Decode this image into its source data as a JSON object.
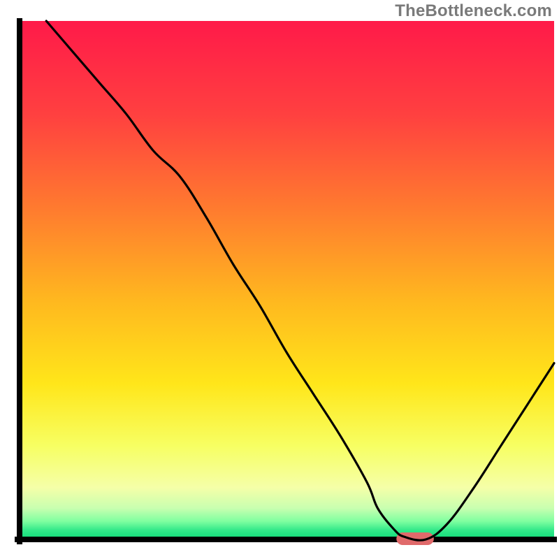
{
  "watermark": "TheBottleneck.com",
  "colors": {
    "curve_stroke": "#000000",
    "axis_stroke": "#000000",
    "marker_fill": "#e06a6b",
    "gradient_stops": [
      {
        "offset": 0.0,
        "color": "#ff1a49"
      },
      {
        "offset": 0.18,
        "color": "#ff4040"
      },
      {
        "offset": 0.36,
        "color": "#ff7a2f"
      },
      {
        "offset": 0.54,
        "color": "#ffb81f"
      },
      {
        "offset": 0.7,
        "color": "#ffe61a"
      },
      {
        "offset": 0.82,
        "color": "#f7ff63"
      },
      {
        "offset": 0.9,
        "color": "#f5ffa8"
      },
      {
        "offset": 0.94,
        "color": "#c8ffb0"
      },
      {
        "offset": 0.965,
        "color": "#7fffa0"
      },
      {
        "offset": 0.982,
        "color": "#33e98a"
      },
      {
        "offset": 1.0,
        "color": "#0dd977"
      }
    ]
  },
  "chart_data": {
    "type": "line",
    "title": "",
    "xlabel": "",
    "ylabel": "",
    "xlim": [
      0,
      100
    ],
    "ylim": [
      0,
      100
    ],
    "series": [
      {
        "name": "curve",
        "x": [
          5,
          10,
          15,
          20,
          25,
          30,
          35,
          40,
          45,
          50,
          55,
          60,
          65,
          67,
          70,
          72,
          76,
          80,
          85,
          90,
          95,
          100
        ],
        "y": [
          100,
          94,
          88,
          82,
          75,
          70,
          62,
          53,
          45,
          36,
          28,
          20,
          11,
          6,
          2,
          0.5,
          0,
          3,
          10,
          18,
          26,
          34
        ]
      }
    ],
    "marker": {
      "x_start": 70.5,
      "x_end": 77.5,
      "y": 0
    },
    "annotations": []
  }
}
